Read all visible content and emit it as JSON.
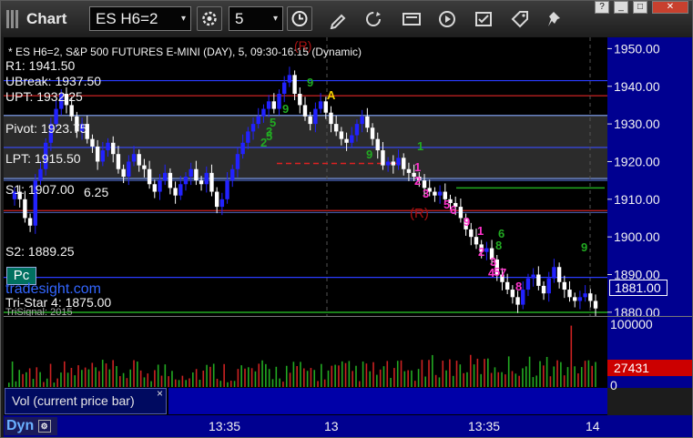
{
  "window": {
    "title": "Chart",
    "symbol": "ES H6=2",
    "interval": "5",
    "controls": [
      "?",
      "_",
      "□",
      "✕"
    ]
  },
  "chart": {
    "header": "* ES H6=2, S&P 500 FUTURES E-MINI (DAY), 5, 09:30-16:15 (Dynamic)",
    "levels": {
      "r1": "R1: 1941.50",
      "ubreak": "UBreak: 1937.50",
      "upt": "UPT: 1932.25",
      "pivot": "Pivot: 1923.75",
      "lpt": "LPT: 1915.50",
      "s1": "S1: 1907.00",
      "s1_extra": "6.25",
      "s2": "S2: 1889.25",
      "tristar": "Tri-Star 4: 1875.00",
      "trisignal": "TriSignal: 2015"
    },
    "pc_button": "Pc",
    "watermark": "tradesight.com",
    "top_marker": "(R)",
    "mid_marker": "(R)",
    "a_marker": "A",
    "price_ticks": [
      "1950.00",
      "1940.00",
      "1930.00",
      "1920.00",
      "1910.00",
      "1900.00",
      "1890.00",
      "1880.00"
    ],
    "last_price": "1881.00",
    "seq_labels_pink": [
      "1",
      "2",
      "3",
      "5",
      "6",
      "9",
      "1",
      "2",
      "3",
      "5",
      "4",
      "7",
      "8"
    ],
    "seq_labels_green": [
      "9",
      "9",
      "5",
      "9",
      "1",
      "2",
      "3",
      "5",
      "6",
      "8",
      "9"
    ]
  },
  "volume": {
    "ticks": [
      "100000",
      "0"
    ],
    "current": "27431",
    "legend": "Vol (current price bar)",
    "legend_close": "×"
  },
  "xaxis": {
    "dyn_label": "Dyn",
    "time_labels": [
      "13:35",
      "13",
      "13:35",
      "14"
    ]
  },
  "colors": {
    "axis_bg": "#000090",
    "bull": "#2222ff",
    "bear": "#ffffff",
    "pivot_band": "#2b2b2b",
    "last_price": "#000090",
    "vol_current": "#cc0000",
    "pink": "#ff33cc",
    "green": "#22aa22"
  },
  "chart_data": {
    "type": "candlestick",
    "title": "* ES H6=2, S&P 500 FUTURES E-MINI (DAY), 5, 09:30-16:15 (Dynamic)",
    "ylim": [
      1879,
      1953
    ],
    "x_tick_labels": [
      "13:35",
      "13",
      "13:35",
      "14"
    ],
    "levels": {
      "R1": 1941.5,
      "UBreak": 1937.5,
      "UPT": 1932.25,
      "Pivot": 1923.75,
      "LPT": 1915.5,
      "S1": 1907.0,
      "S2": 1889.25
    },
    "close": [
      1912,
      1910,
      1905,
      1903,
      1915,
      1918,
      1925,
      1930,
      1934,
      1938,
      1935,
      1932,
      1928,
      1930,
      1926,
      1924,
      1920,
      1923,
      1925,
      1922,
      1918,
      1916,
      1920,
      1922,
      1919,
      1918,
      1914,
      1912,
      1915,
      1917,
      1913,
      1911,
      1914,
      1916,
      1918,
      1915,
      1914,
      1917,
      1912,
      1908,
      1910,
      1915,
      1918,
      1922,
      1925,
      1928,
      1930,
      1932,
      1934,
      1936,
      1934,
      1938,
      1941,
      1943,
      1938,
      1935,
      1932,
      1930,
      1934,
      1936,
      1933,
      1930,
      1928,
      1926,
      1925,
      1927,
      1930,
      1932,
      1929,
      1926,
      1923,
      1919,
      1920,
      1919,
      1921,
      1918,
      1917,
      1916,
      1915,
      1913,
      1912,
      1911,
      1912,
      1910,
      1909,
      1908,
      1905,
      1902,
      1900,
      1898,
      1896,
      1897,
      1894,
      1890,
      1888,
      1886,
      1884,
      1882,
      1886,
      1889,
      1890,
      1887,
      1885,
      1889,
      1892,
      1888,
      1886,
      1884,
      1883,
      1884,
      1885,
      1883,
      1881
    ],
    "volume_max": 100000,
    "volume_current": 27431
  }
}
